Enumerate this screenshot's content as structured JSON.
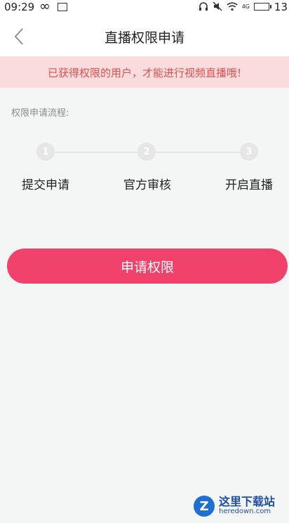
{
  "status_bar": {
    "time": "09:29",
    "infinity_glyph": "∞",
    "network": "4G",
    "battery_level": "13"
  },
  "header": {
    "title": "直播权限申请"
  },
  "notice": {
    "text": "已获得权限的用户，才能进行视频直播哦!"
  },
  "process": {
    "title": "权限申请流程:",
    "steps": [
      {
        "number": "1",
        "label": "提交申请"
      },
      {
        "number": "2",
        "label": "官方审核"
      },
      {
        "number": "3",
        "label": "开启直播"
      }
    ]
  },
  "actions": {
    "apply_label": "申请权限"
  },
  "watermark": {
    "cn": "这里下载站",
    "en": "heredown.com"
  },
  "colors": {
    "accent": "#f0426b",
    "notice_bg": "#fbdcdc",
    "notice_text": "#e4504f",
    "background": "#f4f5f5"
  }
}
